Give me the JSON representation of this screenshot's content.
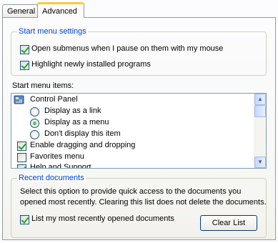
{
  "tabs": [
    {
      "label": "General",
      "active": false
    },
    {
      "label": "Advanced",
      "active": true
    }
  ],
  "start_menu_settings": {
    "title": "Start menu settings",
    "options": [
      {
        "label": "Open submenus when I pause on them with my mouse",
        "checked": true
      },
      {
        "label": "Highlight newly installed programs",
        "checked": true
      }
    ]
  },
  "start_menu_items": {
    "label": "Start menu items:",
    "items": [
      {
        "label": "Control Panel",
        "kind": "header",
        "icon": "control-panel-icon"
      },
      {
        "label": "Display as a link",
        "kind": "radio",
        "checked": false
      },
      {
        "label": "Display as a menu",
        "kind": "radio",
        "checked": true
      },
      {
        "label": "Don't display this item",
        "kind": "radio",
        "checked": false
      },
      {
        "label": "Enable dragging and dropping",
        "kind": "checkbox",
        "checked": true
      },
      {
        "label": "Favorites menu",
        "kind": "checkbox",
        "checked": false
      },
      {
        "label": "Help and Support",
        "kind": "checkbox",
        "checked": true
      }
    ]
  },
  "recent_documents": {
    "title": "Recent documents",
    "description": "Select this option to provide quick access to the documents you opened most recently.  Clearing this list does not delete the documents.",
    "description_line1": "Select this option to provide quick access to the documents you",
    "description_line2": "opened most recently.  Clearing this list does not delete the documents.",
    "list_option": {
      "label": "List my most recently opened documents",
      "checked": true
    },
    "clear_button": "Clear List"
  },
  "colors": {
    "group_title": "#0046d5",
    "check_mark": "#21a121",
    "tab_highlight": "#ffc83c"
  }
}
